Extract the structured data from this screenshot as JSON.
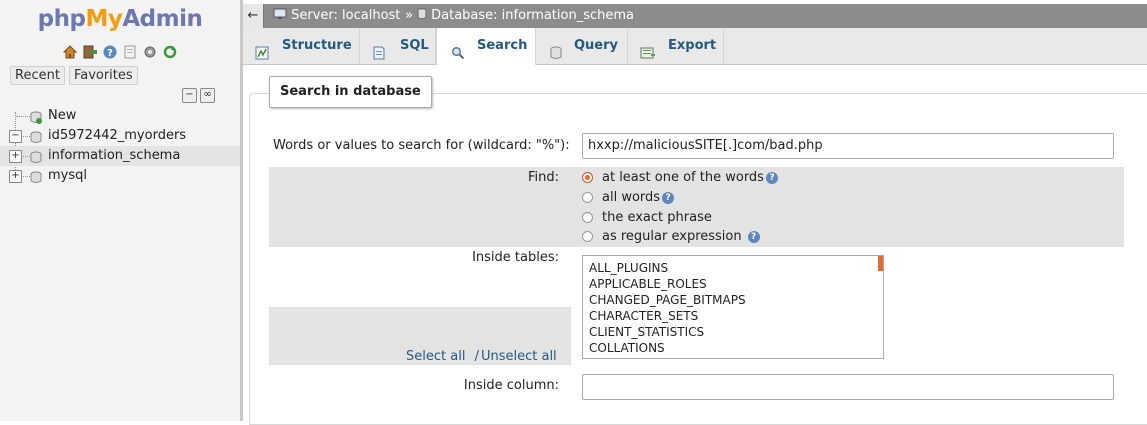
{
  "logo": {
    "php": "php",
    "my": "My",
    "admin": "Admin"
  },
  "nav_icons": [
    "home-icon",
    "exit-icon",
    "help-icon",
    "docs-icon",
    "settings-icon",
    "reload-icon"
  ],
  "nav_tabs": {
    "recent": "Recent",
    "favorites": "Favorites"
  },
  "tree": {
    "items": [
      {
        "label": "New"
      },
      {
        "label": "id5972442_myorders"
      },
      {
        "label": "information_schema"
      },
      {
        "label": "mysql"
      }
    ]
  },
  "breadcrumb": {
    "back": "←",
    "server": "Server: localhost",
    "separator": "»",
    "database": "Database: information_schema"
  },
  "tabs": [
    {
      "label": "Structure",
      "icon": "structure-icon"
    },
    {
      "label": "SQL",
      "icon": "sql-icon"
    },
    {
      "label": "Search",
      "icon": "search-icon"
    },
    {
      "label": "Query",
      "icon": "query-icon"
    },
    {
      "label": "Export",
      "icon": "export-icon"
    }
  ],
  "active_tab": "Search",
  "form": {
    "legend": "Search in database",
    "words_label": "Words or values to search for (wildcard: \"%\"):",
    "words_value": "hxxp://maliciousSITE[.]com/bad.php",
    "find_label": "Find:",
    "find_options": [
      {
        "label": "at least one of the words",
        "checked": true,
        "help": true
      },
      {
        "label": "all words",
        "checked": false,
        "help": true
      },
      {
        "label": "the exact phrase",
        "checked": false,
        "help": false
      },
      {
        "label": "as regular expression",
        "checked": false,
        "help": true
      }
    ],
    "tables_label": "Inside tables:",
    "tables": [
      "ALL_PLUGINS",
      "APPLICABLE_ROLES",
      "CHANGED_PAGE_BITMAPS",
      "CHARACTER_SETS",
      "CLIENT_STATISTICS",
      "COLLATIONS"
    ],
    "select_all": "Select all",
    "link_separator": "/",
    "unselect_all": "Unselect all",
    "column_label": "Inside column:",
    "column_value": ""
  },
  "colors": {
    "accent": "#e9682c",
    "link": "#235a81",
    "breadcrumb_bg": "#8c8c8c"
  }
}
